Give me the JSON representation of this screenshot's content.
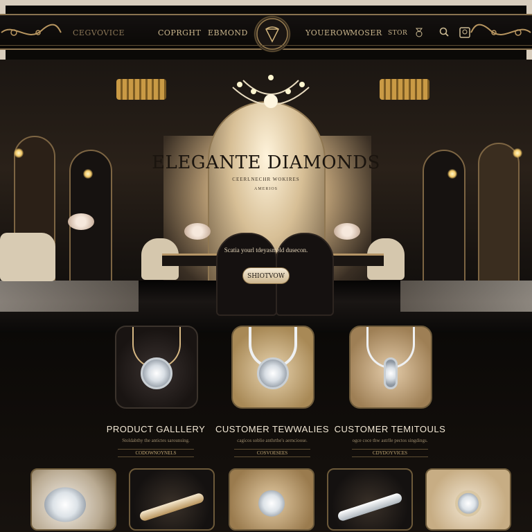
{
  "nav": {
    "brand": "CEGVOVICE",
    "links": [
      "COPRGHT",
      "EBMOND",
      "YOUEROW",
      "MOSER",
      "STOR"
    ],
    "icons": [
      "ring-icon",
      "search-icon",
      "account-icon"
    ]
  },
  "hero": {
    "title": "ELEGANTE DIAMONDS",
    "subtitle": "CEERLNECHR WOKIRES",
    "subtitle2": "AMERIOS",
    "tagline": "Scatia yourl tdeyasmeld dusecon.",
    "button": "SHIOTVOW"
  },
  "products": {
    "cards": [
      {
        "title": "PRODUCT GALLLERY",
        "desc": "Stoldabthy the antictes sarounsing.",
        "link": "CODOWNOYNELS"
      },
      {
        "title": "CUSTOMER TEWWALIES",
        "desc": "cagicos soblie anthrthe's aerncioose.",
        "link": "COSVOESEES"
      },
      {
        "title": "CUSTOMER TEMITOULS",
        "desc": "ogce coce thw astrlle pectos singdings.",
        "link": "CDYDOYVICES"
      }
    ]
  },
  "colors": {
    "accent": "#c9a36a",
    "background": "#0b0907"
  }
}
